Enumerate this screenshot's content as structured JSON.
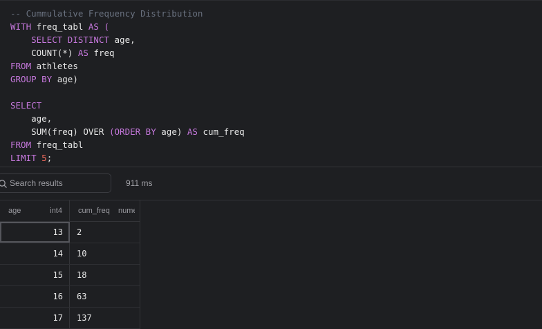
{
  "editor": {
    "lines": [
      [
        {
          "t": "-- Cummulative Frequency Distribution",
          "c": "cm"
        }
      ],
      [
        {
          "t": "WITH",
          "c": "kw"
        },
        {
          "t": " freq_tabl ",
          "c": "id"
        },
        {
          "t": "AS",
          "c": "kw"
        },
        {
          "t": " (",
          "c": "kw"
        }
      ],
      [
        {
          "t": "    ",
          "c": "id"
        },
        {
          "t": "SELECT DISTINCT",
          "c": "kw"
        },
        {
          "t": " age,",
          "c": "id"
        }
      ],
      [
        {
          "t": "    ",
          "c": "id"
        },
        {
          "t": "COUNT(",
          "c": "id"
        },
        {
          "t": "*",
          "c": "id"
        },
        {
          "t": ") ",
          "c": "id"
        },
        {
          "t": "AS",
          "c": "kw"
        },
        {
          "t": " freq",
          "c": "id"
        }
      ],
      [
        {
          "t": "FROM",
          "c": "kw"
        },
        {
          "t": " athletes",
          "c": "id"
        }
      ],
      [
        {
          "t": "GROUP BY",
          "c": "kw"
        },
        {
          "t": " age)",
          "c": "id"
        }
      ],
      [],
      [
        {
          "t": "SELECT",
          "c": "kw"
        }
      ],
      [
        {
          "t": "    age,",
          "c": "id"
        }
      ],
      [
        {
          "t": "    SUM(freq) OVER ",
          "c": "id"
        },
        {
          "t": "(",
          "c": "kw"
        },
        {
          "t": "ORDER BY",
          "c": "kw"
        },
        {
          "t": " age) ",
          "c": "id"
        },
        {
          "t": "AS",
          "c": "kw"
        },
        {
          "t": " cum_freq",
          "c": "id"
        }
      ],
      [
        {
          "t": "FROM",
          "c": "kw"
        },
        {
          "t": " freq_tabl",
          "c": "id"
        }
      ],
      [
        {
          "t": "LIMIT",
          "c": "kw"
        },
        {
          "t": " ",
          "c": "id"
        },
        {
          "t": "5",
          "c": "num"
        },
        {
          "t": ";",
          "c": "id"
        }
      ]
    ]
  },
  "toolbar": {
    "search_placeholder": "Search results",
    "timing": "911 ms"
  },
  "results": {
    "columns": [
      {
        "name": "age",
        "type": "int4"
      },
      {
        "name": "cum_freq",
        "type": "numeric"
      }
    ],
    "rows": [
      [
        "13",
        "2"
      ],
      [
        "14",
        "10"
      ],
      [
        "15",
        "18"
      ],
      [
        "16",
        "63"
      ],
      [
        "17",
        "137"
      ]
    ]
  },
  "icons": {
    "search": "search-icon"
  }
}
